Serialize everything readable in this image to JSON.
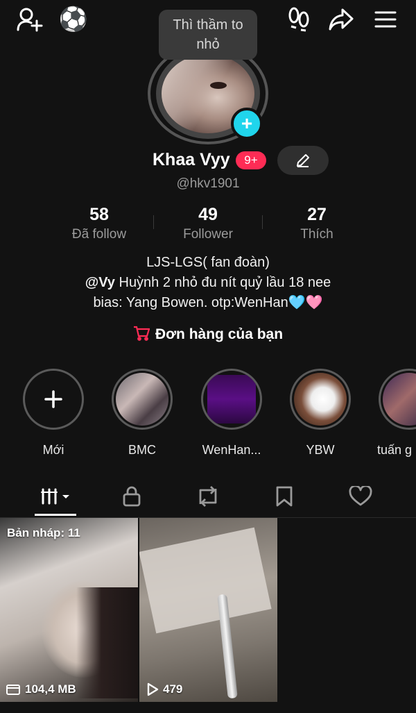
{
  "header": {
    "add_user_icon": "add-user-icon",
    "ball_emoji": "⚽",
    "footprint_icon": "footprints-icon",
    "share_icon": "share-arrow-icon",
    "menu_icon": "hamburger-menu-icon"
  },
  "tooltip": "Thì thầm to nhỏ",
  "profile": {
    "name": "Khaa Vyy",
    "badge": "9+",
    "handle": "@hkv1901",
    "add_button": "+"
  },
  "stats": [
    {
      "value": "58",
      "label": "Đã follow"
    },
    {
      "value": "49",
      "label": "Follower"
    },
    {
      "value": "27",
      "label": "Thích"
    }
  ],
  "bio": {
    "line1": "LJS-LGS( fan đoàn)",
    "mention": "@Vy",
    "line2_rest": " Huỳnh 2 nhỏ đu nít quỷ lầu 18 nee",
    "line3": "bias: Yang Bowen. otp:WenHan🩵🩷"
  },
  "orders_label": "Đơn hàng của bạn",
  "highlights": [
    {
      "label": "Mới"
    },
    {
      "label": "BMC"
    },
    {
      "label": "WenHan..."
    },
    {
      "label": "YBW"
    },
    {
      "label": "tuấn g"
    }
  ],
  "tabs": [
    "videos-grid-icon",
    "lock-icon",
    "repost-icon",
    "bookmark-icon",
    "heart-icon"
  ],
  "grid": {
    "draft_label": "Bản nháp: 11",
    "draft_size": "104,4 MB",
    "video_views": "479"
  },
  "colors": {
    "background": "#121212",
    "accent_red": "#fe2c55",
    "accent_cyan": "#20d5ec"
  }
}
